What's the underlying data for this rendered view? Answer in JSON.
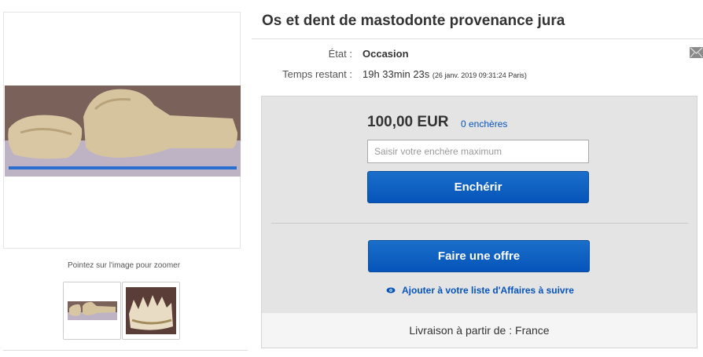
{
  "listing": {
    "title": "Os et dent de mastodonte provenance jura"
  },
  "gallery": {
    "zoom_hint": "Pointez sur l'image pour zoomer",
    "thumbnails": [
      "bone-photo",
      "tooth-photo"
    ]
  },
  "details": {
    "condition_label": "État :",
    "condition_value": "Occasion",
    "time_label": "Temps restant :",
    "time_value": "19h 33min 23s",
    "time_end": "(26 janv. 2019   09:31:24 Paris)"
  },
  "bidding": {
    "price": "100,00 EUR",
    "bids": "0 enchères",
    "input_placeholder": "Saisir votre enchère maximum",
    "bid_button": "Enchérir",
    "offer_button": "Faire une offre",
    "watch_link": "Ajouter à votre liste d'Affaires à suivre",
    "shipping": "Livraison à partir de : France"
  },
  "colors": {
    "link": "#0654ba",
    "button": "#0654ba",
    "panel": "#e4e4e4"
  }
}
